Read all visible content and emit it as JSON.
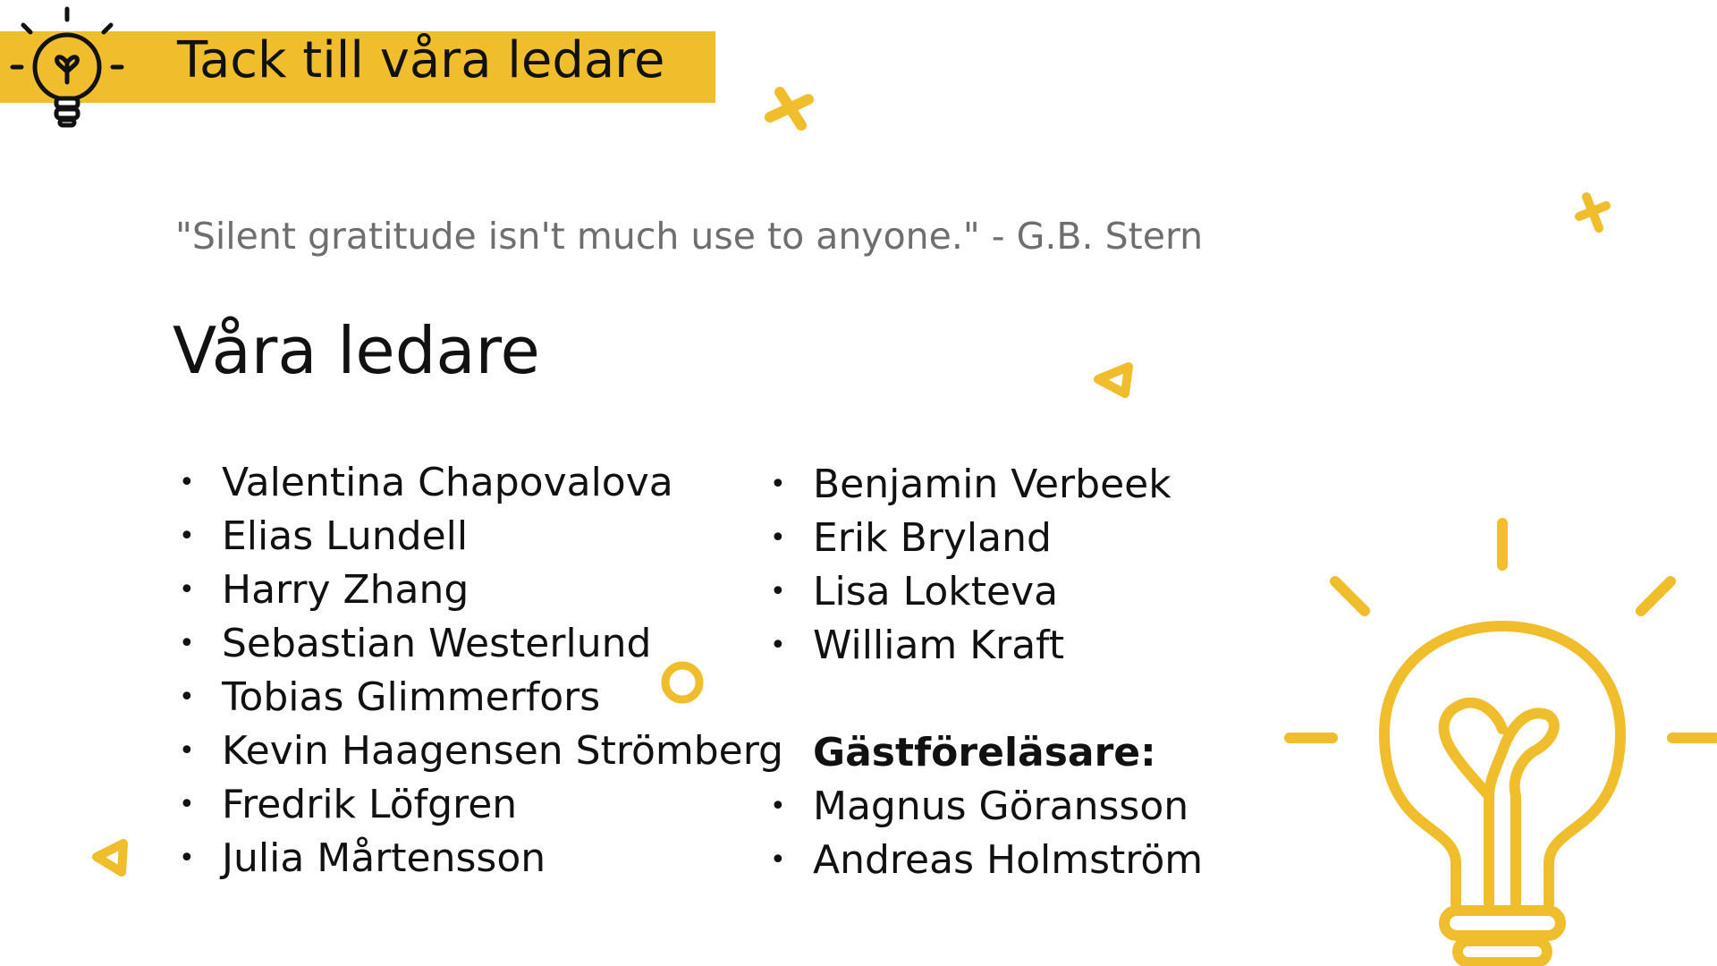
{
  "title": "Tack till våra ledare",
  "quote": "\"Silent gratitude isn't much use to anyone.\" - G.B. Stern",
  "subtitle": "Våra ledare",
  "leaders_col1": [
    "Valentina Chapovalova",
    "Elias Lundell",
    "Harry Zhang",
    "Sebastian Westerlund",
    "Tobias Glimmerfors",
    "Kevin Haagensen Strömberg",
    "Fredrik Löfgren",
    "Julia Mårtensson"
  ],
  "leaders_col2": [
    "Benjamin Verbeek",
    "Erik Bryland",
    "Lisa Lokteva",
    "William Kraft"
  ],
  "guest_heading": "Gästföreläsare:",
  "guests": [
    "Magnus Göransson",
    "Andreas Holmström"
  ],
  "bullet": "•",
  "colors": {
    "accent": "#f0be2c",
    "text": "#111111",
    "quote": "#6e6e6e"
  },
  "icons": [
    "lightbulb-heart-icon",
    "cross-shape-icon",
    "triangle-shape-icon",
    "circle-shape-icon"
  ]
}
